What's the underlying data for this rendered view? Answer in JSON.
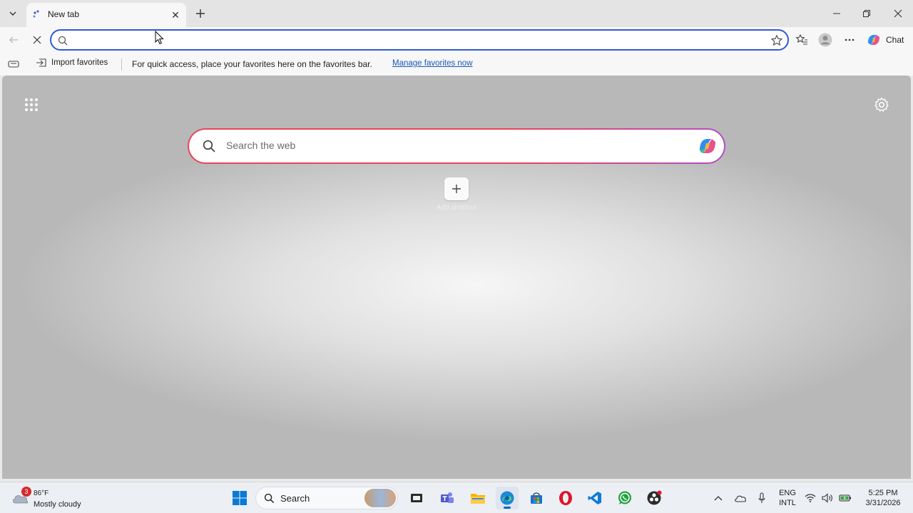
{
  "browser": {
    "tab": {
      "title": "New tab"
    },
    "address_bar": {
      "value": "",
      "placeholder": ""
    },
    "chat_label": "Chat",
    "favorites_bar": {
      "import_label": "Import favorites",
      "message": "For quick access, place your favorites here on the favorites bar.",
      "manage_link": "Manage favorites now"
    }
  },
  "new_tab_page": {
    "search_placeholder": "Search the web",
    "add_shortcut_label": "Add shortcut"
  },
  "taskbar": {
    "weather": {
      "badge": "3",
      "temperature": "86°F",
      "condition": "Mostly cloudy"
    },
    "search_label": "Search",
    "language": {
      "line1": "ENG",
      "line2": "INTL"
    },
    "clock": {
      "time": "5:25 PM",
      "date": "3/31/2026"
    }
  },
  "colors": {
    "address_focus": "#2f5ad8",
    "search_border_start": "#e9455a",
    "search_border_end": "#b04fc6",
    "link": "#1a56b8",
    "taskbar_accent": "#0067c0"
  }
}
